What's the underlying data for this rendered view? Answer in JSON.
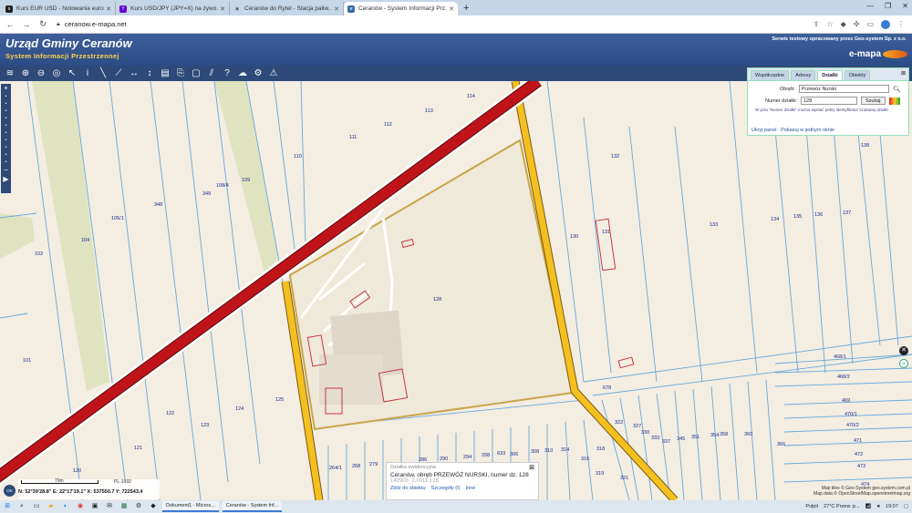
{
  "browser": {
    "tabs": [
      {
        "title": "Kurs EUR USD - Notowania euro...",
        "icon": "stooq-icon",
        "color": "#222"
      },
      {
        "title": "Kurs USD/JPY (JPY=X) na żywo...",
        "icon": "yahoo-icon",
        "color": "#6001d2"
      },
      {
        "title": "Ceranów do Rytel - Stacja paliw...",
        "icon": "maps-pin-icon",
        "color": "#555"
      },
      {
        "title": "Ceranów - System Informacji Prz...",
        "icon": "emapa-icon",
        "color": "#3b6ea5",
        "active": true
      }
    ],
    "new_tab": "+",
    "url": "ceranow.e-mapa.net"
  },
  "header": {
    "title": "Urząd Gminy Ceranów",
    "subtitle": "System Informacji Przestrzennej",
    "right_text": "Serwis testowy opracowany przez Geo-system Sp. z o.o.",
    "brand": "e-mapa"
  },
  "panel": {
    "tabs": [
      "Współrzędne",
      "Adresy",
      "Działki",
      "Obiekty"
    ],
    "active_tab": "Działki",
    "obreb_label": "Obręb:",
    "obreb_value": "Przewóz Nurski",
    "numer_label": "Numer działki:",
    "numer_value": "128",
    "search_button": "Szukaj",
    "hint": "W polu \"Numer działki\" można wpisać pełny identyfikator szukanej działki",
    "link_hide": "Ukryj panel",
    "link_one": "Pokazuj w jednym oknie"
  },
  "info": {
    "header": "Działka ewidencyjna",
    "line1": "Ceranów, obręb PRZEWÓZ NURSKI, numer dz. 128",
    "line2": "142903_2.0011.128",
    "link_zoom": "Zbliż do obiektu",
    "link_details": "Szczegóły (I)",
    "link_other": "Inne"
  },
  "scale": {
    "label": "70m",
    "crs": "PL-1992"
  },
  "coords": "N: 52°39'28.8\"  E: 22°17'19.1\"  X: 537550.7  Y: 722543.4",
  "ok_button": "OK",
  "attribution": [
    "Map tiles © Geo-System geo.system.com.pl",
    "Map data © OpenStreetMap.openstreetmap.org"
  ],
  "map_labels": [
    {
      "t": "114"
    },
    {
      "t": "113"
    },
    {
      "t": "112"
    },
    {
      "t": "111"
    },
    {
      "t": "110"
    },
    {
      "t": "108/4"
    },
    {
      "t": "109"
    },
    {
      "t": "349"
    },
    {
      "t": "348"
    },
    {
      "t": "105/1"
    },
    {
      "t": "104"
    },
    {
      "t": "102"
    },
    {
      "t": "101"
    },
    {
      "t": "128"
    },
    {
      "t": "130"
    },
    {
      "t": "131"
    },
    {
      "t": "132"
    },
    {
      "t": "133"
    },
    {
      "t": "134"
    },
    {
      "t": "135"
    },
    {
      "t": "136"
    },
    {
      "t": "137"
    },
    {
      "t": "138"
    },
    {
      "t": "125"
    },
    {
      "t": "124"
    },
    {
      "t": "123"
    },
    {
      "t": "122"
    },
    {
      "t": "121"
    },
    {
      "t": "120"
    },
    {
      "t": "264/1"
    },
    {
      "t": "268"
    },
    {
      "t": "279"
    },
    {
      "t": "286"
    },
    {
      "t": "290"
    },
    {
      "t": "294"
    },
    {
      "t": "298"
    },
    {
      "t": "633"
    },
    {
      "t": "306"
    },
    {
      "t": "308"
    },
    {
      "t": "310"
    },
    {
      "t": "314"
    },
    {
      "t": "316"
    },
    {
      "t": "318"
    },
    {
      "t": "319"
    },
    {
      "t": "321"
    },
    {
      "t": "322"
    },
    {
      "t": "327"
    },
    {
      "t": "330"
    },
    {
      "t": "333"
    },
    {
      "t": "337"
    },
    {
      "t": "345"
    },
    {
      "t": "351"
    },
    {
      "t": "354"
    },
    {
      "t": "358"
    },
    {
      "t": "360"
    },
    {
      "t": "366"
    },
    {
      "t": "678"
    },
    {
      "t": "468/1"
    },
    {
      "t": "468/2"
    },
    {
      "t": "469"
    },
    {
      "t": "470/1"
    },
    {
      "t": "470/2"
    },
    {
      "t": "471"
    },
    {
      "t": "472"
    },
    {
      "t": "473"
    },
    {
      "t": "474"
    }
  ],
  "taskbar": {
    "windows": [
      "Dokument1 - Micros...",
      "Ceranów - System Inf..."
    ],
    "pulpit": "Pulpit",
    "weather": "27°C  Przew. p...",
    "time": "19:07"
  },
  "colors": {
    "header": "#3e5f9b",
    "toolbar": "#2d4a79",
    "road_main": "#c0141b",
    "road_secondary": "#f4c020",
    "parcel_lines": "#6aa8d8",
    "map_bg": "#f3ede2"
  }
}
